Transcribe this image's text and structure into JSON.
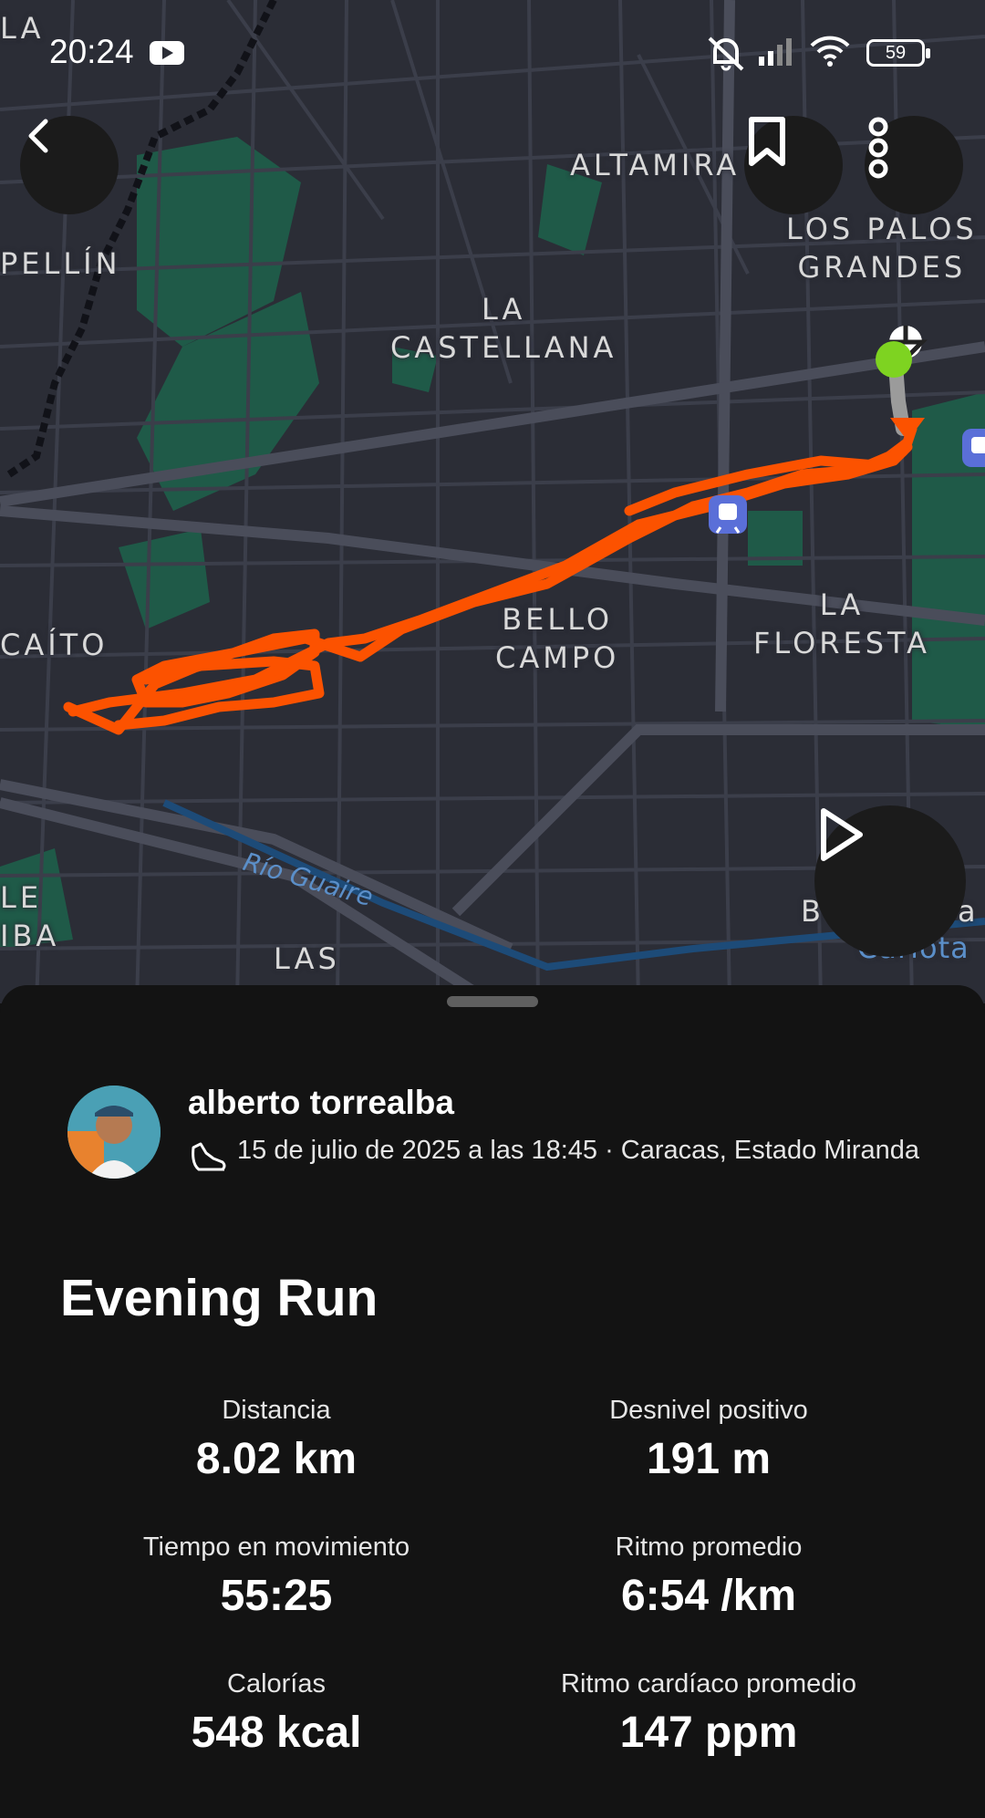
{
  "status_bar": {
    "time": "20:24",
    "battery": "59",
    "icons": [
      "youtube-icon",
      "bell-off-icon",
      "signal-icon",
      "wifi-icon",
      "battery-icon"
    ]
  },
  "map": {
    "labels": {
      "la_top": "LA",
      "altamira": "ALTAMIRA",
      "los_palos_grandes": "LOS PALOS\nGRANDES",
      "pellin": "PELLÍN",
      "la_castellana": "LA\nCASTELLANA",
      "bello_campo": "BELLO\nCAMPO",
      "la_floresta": "LA\nFLORESTA",
      "caito": "CAÍTO",
      "le_iba": "LE\nIBA",
      "las": "LAS",
      "rio_guaire": "Río Guaire",
      "b_partial": "B",
      "a_partial": "a",
      "carlota_partial": "Carlota"
    },
    "colors": {
      "route": "#fc5200",
      "start": "#7ed321",
      "background": "#2b2d36",
      "park": "#1f5a48"
    },
    "buttons": {
      "back": "chevron-left-icon",
      "bookmark": "bookmark-icon",
      "more": "more-vertical-icon",
      "play": "play-icon"
    }
  },
  "activity": {
    "athlete": "alberto torrealba",
    "meta": "15 de julio de 2025 a las 18:45 · Caracas, Estado Miranda",
    "title": "Evening Run",
    "stats": [
      {
        "label": "Distancia",
        "value": "8.02 km"
      },
      {
        "label": "Desnivel positivo",
        "value": "191 m"
      },
      {
        "label": "Tiempo en movimiento",
        "value": "55:25"
      },
      {
        "label": "Ritmo promedio",
        "value": "6:54 /km"
      },
      {
        "label": "Calorías",
        "value": "548 kcal"
      },
      {
        "label": "Ritmo cardíaco promedio",
        "value": "147 ppm"
      }
    ]
  }
}
